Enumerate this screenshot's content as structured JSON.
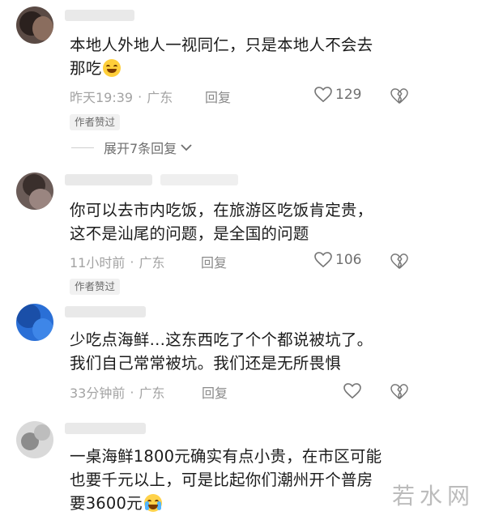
{
  "comments": [
    {
      "text_line1": "本地人外地人一视同仁，只是本地人不会去",
      "text_line2": "那吃",
      "emoji": "grin-sweat-emoji",
      "time": "昨天19:39",
      "location": "广东",
      "reply_label": "回复",
      "likes": "129",
      "author_liked": "作者赞过",
      "expand_label": "展开7条回复"
    },
    {
      "text_line1": "你可以去市内吃饭，在旅游区吃饭肯定贵，",
      "text_line2": "这不是汕尾的问题，是全国的问题",
      "time": "11小时前",
      "location": "广东",
      "reply_label": "回复",
      "likes": "106",
      "author_liked": "作者赞过"
    },
    {
      "text_line1": "少吃点海鲜…这东西吃了个个都说被坑了。",
      "text_line2": "我们自己常常被坑。我们还是无所畏惧",
      "time": "33分钟前",
      "location": "广东",
      "reply_label": "回复"
    },
    {
      "text_line1": "一桌海鲜1800元确实有点小贵，在市区可能",
      "text_line2": "也要千元以上，可是比起你们潮州开个普房",
      "text_line3": "要3600元",
      "emoji": "crying-emoji"
    }
  ],
  "separator": "·",
  "watermark": "若水网",
  "colors": {
    "meta": "#a3a3a3",
    "badge_bg": "#f1f1f1",
    "text": "#1b1b1b"
  }
}
